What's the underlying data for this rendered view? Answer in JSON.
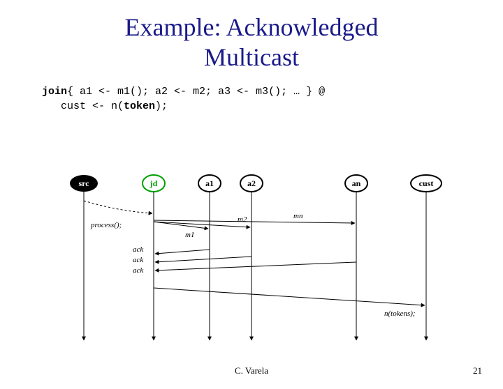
{
  "title_line1": "Example: Acknowledged",
  "title_line2": "Multicast",
  "code_line1_a": "join",
  "code_line1_b": "{ a1 <- m1(); a2 <- m2; a3 <- m3(); … } @",
  "code_line2_a": "   cust <- n(",
  "code_line2_b": "token",
  "code_line2_c": ");",
  "diagram": {
    "nodes": [
      "src",
      "jd",
      "a1",
      "a2",
      "an",
      "cust"
    ],
    "jd_color": "#00a000",
    "msg_m1": "m1",
    "msg_m2": "m2",
    "msg_mn": "mn",
    "ack": "ack",
    "process_label": "process();",
    "return_label": "n(tokens);"
  },
  "footer_author": "C. Varela",
  "footer_page": "21"
}
